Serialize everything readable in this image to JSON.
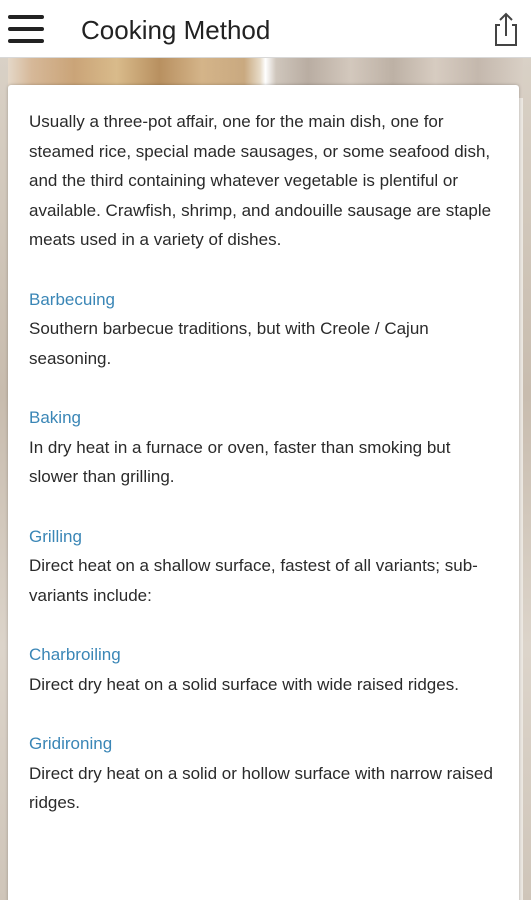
{
  "appbar": {
    "title": "Cooking Method",
    "menu_icon": "hamburger-menu-icon",
    "share_icon": "share-icon"
  },
  "content": {
    "intro": "Usually a three-pot affair, one for the main dish, one for steamed rice, special made sausages, or some seafood dish, and the third containing whatever vegetable is plentiful or available. Crawfish, shrimp, and andouille sausage are staple meats used in a variety of dishes.",
    "sections": [
      {
        "title": "Barbecuing",
        "body": "Southern barbecue traditions, but with Creole / Cajun seasoning."
      },
      {
        "title": "Baking",
        "body": "In dry heat in a furnace or oven, faster than smoking but slower than grilling."
      },
      {
        "title": "Grilling",
        "body": "Direct heat on a shallow surface, fastest of all variants; sub-variants include:"
      },
      {
        "title": "Charbroiling",
        "body": "Direct dry heat on a solid surface with wide raised ridges."
      },
      {
        "title": "Gridironing",
        "body": "Direct dry heat on a solid or hollow surface with narrow raised ridges."
      }
    ]
  },
  "colors": {
    "section_title": "#3a86b6",
    "text": "#2a2a2a",
    "appbar_bg": "#ffffff"
  }
}
